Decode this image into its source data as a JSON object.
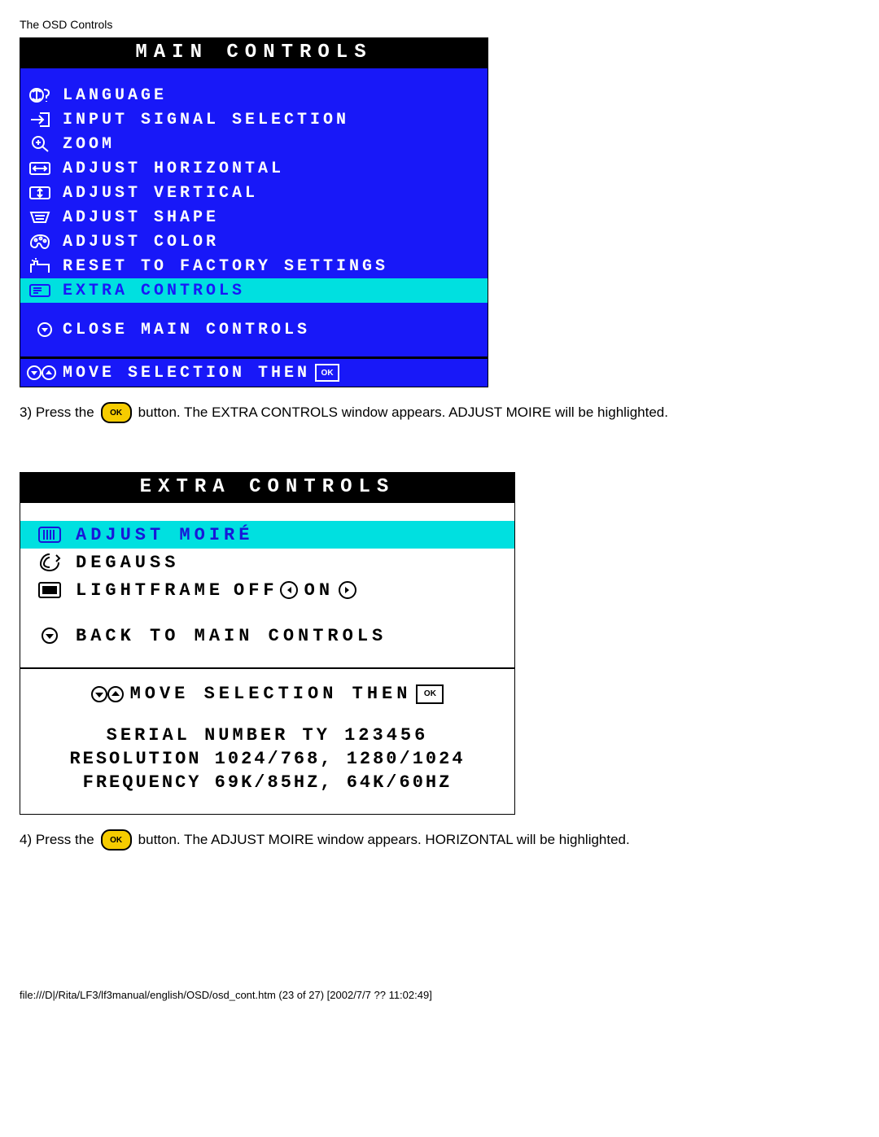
{
  "page_header": "The OSD Controls",
  "main_controls": {
    "title": "MAIN CONTROLS",
    "items": [
      {
        "label": "LANGUAGE",
        "icon": "globe-question-icon",
        "highlight": false
      },
      {
        "label": "INPUT SIGNAL SELECTION",
        "icon": "input-arrow-icon",
        "highlight": false
      },
      {
        "label": "ZOOM",
        "icon": "magnifier-icon",
        "highlight": false
      },
      {
        "label": "ADJUST HORIZONTAL",
        "icon": "horiz-adjust-icon",
        "highlight": false
      },
      {
        "label": "ADJUST VERTICAL",
        "icon": "vert-adjust-icon",
        "highlight": false
      },
      {
        "label": "ADJUST SHAPE",
        "icon": "shape-adjust-icon",
        "highlight": false
      },
      {
        "label": "ADJUST COLOR",
        "icon": "palette-icon",
        "highlight": false
      },
      {
        "label": "RESET TO FACTORY SETTINGS",
        "icon": "factory-reset-icon",
        "highlight": false
      },
      {
        "label": "EXTRA CONTROLS",
        "icon": "extra-controls-icon",
        "highlight": true
      }
    ],
    "close_label": "CLOSE MAIN CONTROLS",
    "footer_move": "MOVE SELECTION THEN"
  },
  "step3_before": "3) Press the",
  "step3_after": "button. The EXTRA CONTROLS window appears. ADJUST MOIRE will be highlighted.",
  "extra_controls": {
    "title": "EXTRA CONTROLS",
    "items": [
      {
        "label": "ADJUST MOIRÉ",
        "icon": "moire-icon",
        "highlight": true
      },
      {
        "label": "DEGAUSS",
        "icon": "degauss-icon",
        "highlight": false
      }
    ],
    "lightframe_label": "LIGHTFRAME",
    "lightframe_off": "OFF",
    "lightframe_on": "ON",
    "back_label": "BACK TO MAIN CONTROLS",
    "footer_move": "MOVE SELECTION THEN",
    "serial": "SERIAL NUMBER TY 123456",
    "resolution": "RESOLUTION 1024/768, 1280/1024",
    "frequency": "FREQUENCY 69K/85HZ, 64K/60HZ"
  },
  "step4_before": "4) Press the",
  "step4_after": "button. The ADJUST MOIRE window appears. HORIZONTAL will be highlighted.",
  "ok_label": "OK",
  "page_footer": "file:///D|/Rita/LF3/lf3manual/english/OSD/osd_cont.htm (23 of 27) [2002/7/7 ?? 11:02:49]"
}
